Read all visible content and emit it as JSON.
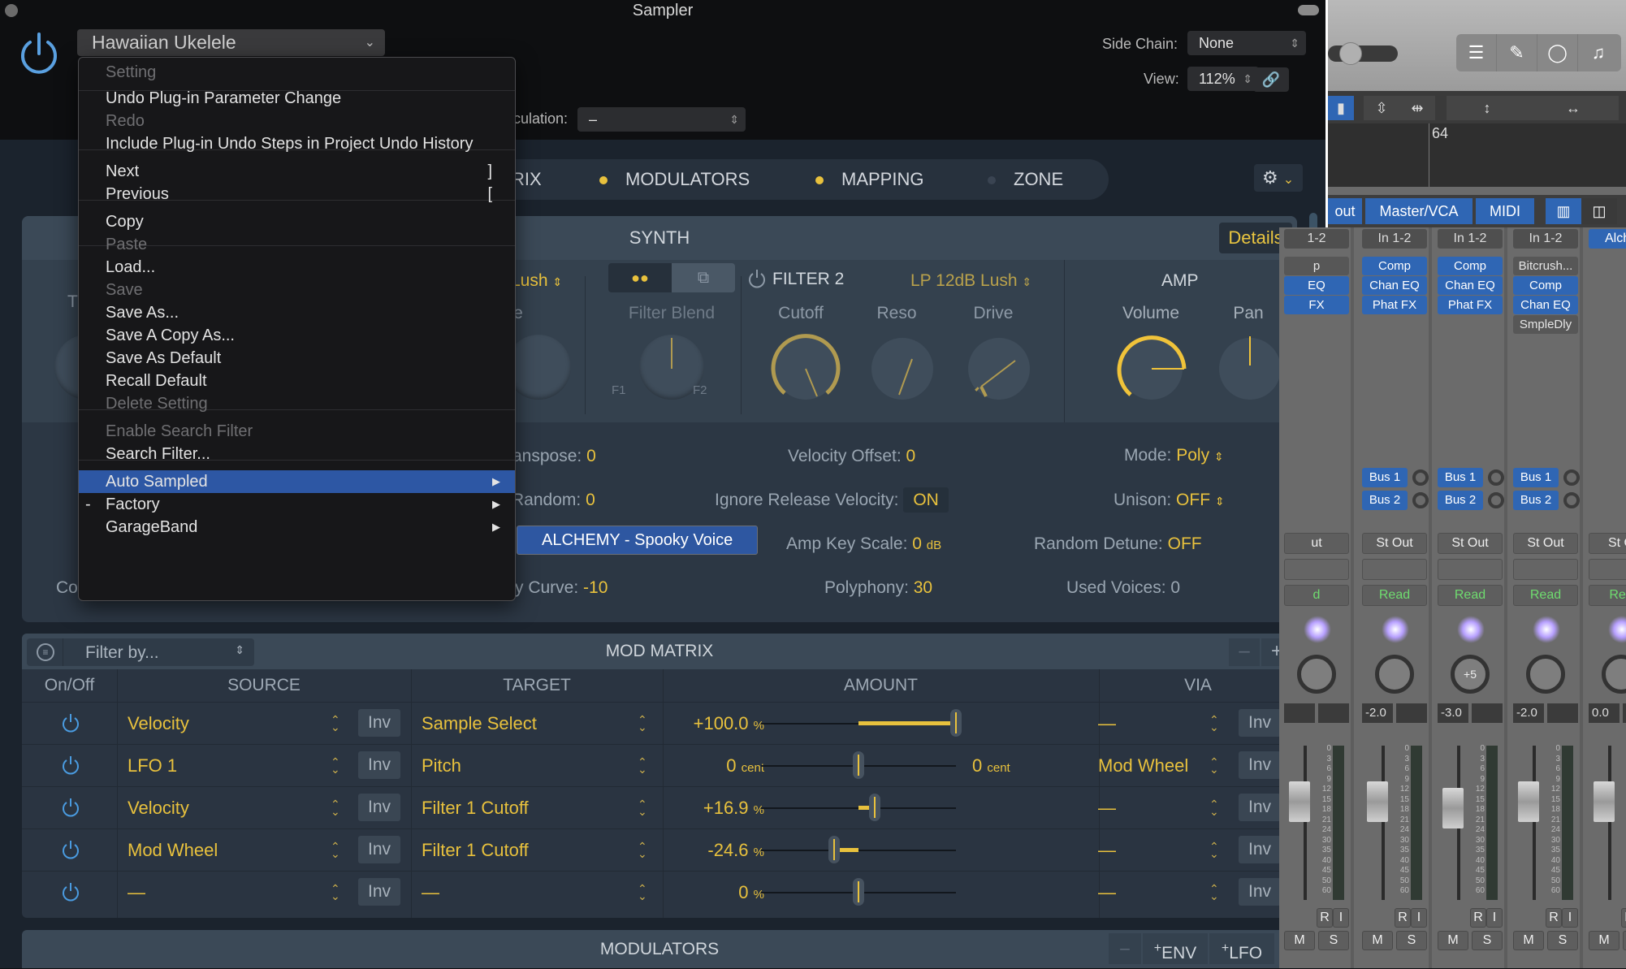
{
  "window": {
    "title": "Sampler"
  },
  "header": {
    "preset_name": "Hawaiian Ukelele",
    "side_chain_label": "Side Chain:",
    "side_chain_value": "None",
    "view_label": "View:",
    "view_value": "112%",
    "articulation_label_partial": "culation:",
    "articulation_value": "–"
  },
  "tabs": [
    {
      "label": "RIX",
      "dot_color": null
    },
    {
      "label": "MODULATORS",
      "dot_color": "#e8c13d"
    },
    {
      "label": "MAPPING",
      "dot_color": "#e8c13d"
    },
    {
      "label": "ZONE",
      "dot_color": "#3a4452"
    }
  ],
  "settings_menu": {
    "header": "Setting",
    "items": [
      {
        "label": "Undo Plug-in Parameter Change",
        "enabled": true
      },
      {
        "label": "Redo",
        "enabled": false
      },
      {
        "label": "Include Plug-in Undo Steps in Project Undo History",
        "enabled": true
      },
      {
        "label": "Next",
        "shortcut": "]",
        "enabled": true
      },
      {
        "label": "Previous",
        "shortcut": "[",
        "enabled": true
      },
      {
        "label": "Copy",
        "enabled": true
      },
      {
        "label": "Paste",
        "enabled": false
      },
      {
        "label": "Load...",
        "enabled": true
      },
      {
        "label": "Save",
        "enabled": false
      },
      {
        "label": "Save As...",
        "enabled": true
      },
      {
        "label": "Save A Copy As...",
        "enabled": true
      },
      {
        "label": "Save As Default",
        "enabled": true
      },
      {
        "label": "Recall Default",
        "enabled": true
      },
      {
        "label": "Delete Setting",
        "enabled": false
      },
      {
        "label": "Enable Search Filter",
        "enabled": false
      },
      {
        "label": "Search Filter...",
        "enabled": true
      },
      {
        "label": "Auto Sampled",
        "enabled": true,
        "submenu": true,
        "selected": true
      },
      {
        "label": "Factory",
        "enabled": true,
        "submenu": true,
        "mark": "-"
      },
      {
        "label": "GarageBand",
        "enabled": true,
        "submenu": true
      }
    ],
    "submenu_item": "ALCHEMY - Spooky Voice"
  },
  "synth": {
    "title": "SYNTH",
    "details_label": "Details",
    "filter1": {
      "type_partial": "Lush",
      "drive_label_partial": "ive",
      "left_label_partial": "T"
    },
    "filter_blend": {
      "label": "Filter Blend",
      "f1": "F1",
      "f2": "F2"
    },
    "filter2": {
      "title": "FILTER 2",
      "type": "LP 12dB Lush",
      "knobs": [
        "Cutoff",
        "Reso",
        "Drive"
      ]
    },
    "amp": {
      "title": "AMP",
      "knobs": [
        "Volume",
        "Pan"
      ]
    },
    "params": {
      "transpose": {
        "label": "anspose:",
        "value": "0"
      },
      "random": {
        "label": "Random:",
        "value": "0"
      },
      "velocity_curve": {
        "label": "y Curve:",
        "value": "-10"
      },
      "velocity_offset": {
        "label": "Velocity Offset:",
        "value": "0"
      },
      "ignore_release_velocity": {
        "label": "Ignore Release Velocity:",
        "value": "ON"
      },
      "amp_key_scale": {
        "label": "Amp Key Scale:",
        "value": "0",
        "unit": "dB"
      },
      "polyphony": {
        "label": "Polyphony:",
        "value": "30"
      },
      "mode": {
        "label": "Mode:",
        "value": "Poly"
      },
      "unison": {
        "label": "Unison:",
        "value": "OFF"
      },
      "random_detune": {
        "label": "Random Detune:",
        "value": "OFF"
      },
      "used_voices": {
        "label": "Used Voices:",
        "value": "0"
      },
      "left_partial": "Co"
    }
  },
  "mod_matrix": {
    "title": "MOD MATRIX",
    "filter_placeholder": "Filter by...",
    "minus": "–",
    "plus": "+",
    "columns": [
      "On/Off",
      "SOURCE",
      "TARGET",
      "AMOUNT",
      "VIA"
    ],
    "inv_label": "Inv",
    "rows": [
      {
        "source": "Velocity",
        "target": "Sample Select",
        "amount": "+100.0",
        "unit": "%",
        "amount_fraction": 1.0,
        "via": "—",
        "via_amount": null
      },
      {
        "source": "LFO 1",
        "target": "Pitch",
        "amount": "0",
        "unit": "cent",
        "amount_fraction": 0.0,
        "via": "Mod Wheel",
        "via_amount": "0",
        "via_unit": "cent"
      },
      {
        "source": "Velocity",
        "target": "Filter 1 Cutoff",
        "amount": "+16.9",
        "unit": "%",
        "amount_fraction": 0.169,
        "via": "—",
        "via_amount": null
      },
      {
        "source": "Mod Wheel",
        "target": "Filter 1 Cutoff",
        "amount": "-24.6",
        "unit": "%",
        "amount_fraction": -0.246,
        "via": "—",
        "via_amount": null
      },
      {
        "source": "—",
        "target": "—",
        "amount": "0",
        "unit": "%",
        "amount_fraction": 0.0,
        "via": "—",
        "via_amount": null
      }
    ]
  },
  "modulators": {
    "title": "MODULATORS",
    "minus": "–",
    "add_env": "ENV",
    "add_lfo": "LFO"
  },
  "logic": {
    "ruler_marker": "64",
    "mixer_tabs": [
      "out",
      "Master/VCA",
      "MIDI"
    ],
    "strips": [
      {
        "input": "1-2",
        "plugins": [
          {
            "name": "p",
            "on": false
          },
          {
            "name": "EQ",
            "on": true
          },
          {
            "name": "FX",
            "on": true
          }
        ],
        "output": "ut",
        "automation": "d",
        "volume": "",
        "partial": true
      },
      {
        "input": "In 1-2",
        "plugins": [
          {
            "name": "Comp",
            "on": true
          },
          {
            "name": "Chan EQ",
            "on": true
          },
          {
            "name": "Phat FX",
            "on": true
          }
        ],
        "sends": [
          "Bus 1",
          "Bus 2"
        ],
        "output": "St Out",
        "automation": "Read",
        "pan": "",
        "volume": "-2.0"
      },
      {
        "input": "In 1-2",
        "plugins": [
          {
            "name": "Comp",
            "on": true
          },
          {
            "name": "Chan EQ",
            "on": true
          },
          {
            "name": "Phat FX",
            "on": true
          }
        ],
        "sends": [
          "Bus 1",
          "Bus 2"
        ],
        "output": "St Out",
        "automation": "Read",
        "pan": "+5",
        "volume": "-3.0"
      },
      {
        "input": "In 1-2",
        "plugins": [
          {
            "name": "Bitcrush...",
            "on": false
          },
          {
            "name": "Comp",
            "on": true
          },
          {
            "name": "Chan EQ",
            "on": true
          },
          {
            "name": "SmpleDly",
            "on": false
          }
        ],
        "sends": [
          "Bus 1",
          "Bus 2"
        ],
        "output": "St Out",
        "automation": "Read",
        "pan": "",
        "volume": "-2.0"
      },
      {
        "input": "Alche",
        "plugins": [],
        "output": "St O",
        "automation": "Rea",
        "volume": "0.0",
        "partial": true
      }
    ],
    "fader_scale": [
      "0",
      "3",
      "6",
      "9",
      "12",
      "15",
      "18",
      "21",
      "24",
      "30",
      "35",
      "40",
      "45",
      "50",
      "60"
    ],
    "buttons": {
      "r": "R",
      "i": "I",
      "m": "M",
      "s": "S"
    }
  }
}
